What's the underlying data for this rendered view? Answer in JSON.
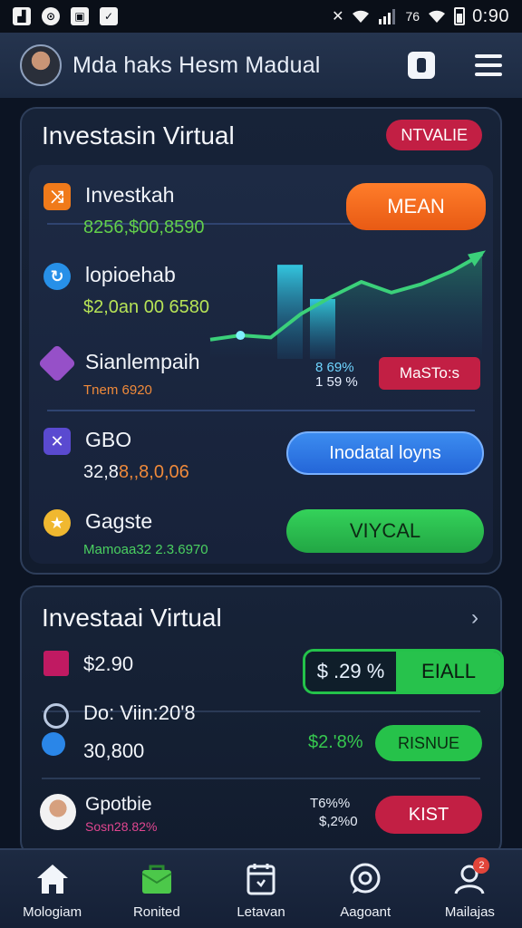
{
  "status_bar": {
    "time": "0:90",
    "signal_text": "76",
    "left_icons": [
      "image-icon",
      "chat-icon",
      "photo-icon",
      "check-icon"
    ],
    "right_icons": [
      "silent-icon",
      "wifi-icon",
      "signal-icon",
      "wifi-icon",
      "battery-icon"
    ]
  },
  "header": {
    "title": "Mda haks Hesm Madual",
    "avatar_icon": "user-avatar",
    "action_icon": "card-icon",
    "menu_icon": "hamburger-menu-icon"
  },
  "card_top": {
    "title": "Investasin Virtual",
    "badge": "NTVALIE",
    "trend_chart": {
      "bars": [
        0.55,
        0.35
      ],
      "line": [
        0.18,
        0.22,
        0.2,
        0.42,
        0.58,
        0.72,
        0.62,
        0.7,
        0.82,
        0.98
      ]
    },
    "rows": [
      {
        "name": "Investkah",
        "value": "8256,$00,8590",
        "value_color": "#63d04b",
        "icon": "shuffle-icon",
        "button": "MEAN",
        "button_color": "#f06a1c"
      },
      {
        "name": "lopioehab",
        "value": "$2,0an 00 6580",
        "value_color": "#b7e356",
        "icon": "refresh-icon"
      },
      {
        "name": "Sianlempaih",
        "value": "Tnem 6920",
        "value_color": "#f08a3a",
        "icon": "crystal-icon",
        "stat_top": "8 69% ",
        "stat_bottom": "1 59 %",
        "button": "MaSTo:s",
        "button_color": "#c21f44"
      },
      {
        "name": "GBO",
        "value_a": "32,8",
        "value_b": "8,,8,0,06",
        "value_color": "#f08a3a",
        "icon": "close-icon",
        "button": "Inodatal loyns",
        "button_color": "#2b7ae6"
      },
      {
        "name": "Gagste",
        "value": "Mamoaa32 2.3.6970",
        "value_color": "#4ad060",
        "icon": "trophy-icon",
        "button": "VIYCAL",
        "button_color": "#2bc24c"
      }
    ]
  },
  "card_bottom": {
    "title": "Investaai Virtual",
    "chevron_icon": "chevron-right-icon",
    "rows": [
      {
        "text": "$2.90",
        "icon": "wallet-icon",
        "gauge_left": "$ .29  %",
        "gauge_right": "EIALL"
      },
      {
        "text_top": "Do: Viin:20'8",
        "text_bottom": "30,800",
        "icon": "clock-icon",
        "stat": "$2.'8%",
        "button": "RISNUE"
      },
      {
        "name": "Gpotbie",
        "sub": "Sosn28.82%",
        "icon": "user-avatar-icon",
        "stat_top": "T6%%",
        "stat_bottom": "$,2%0",
        "button": "KIST"
      }
    ]
  },
  "nav": {
    "items": [
      {
        "label": "Mologiam",
        "icon": "home-icon"
      },
      {
        "label": "Ronited",
        "icon": "shopping-bag-icon"
      },
      {
        "label": "Letavan",
        "icon": "calendar-icon"
      },
      {
        "label": "Aagoant",
        "icon": "chat-bubble-icon"
      },
      {
        "label": "Mailajas",
        "icon": "profile-icon",
        "badge": "2"
      }
    ]
  }
}
